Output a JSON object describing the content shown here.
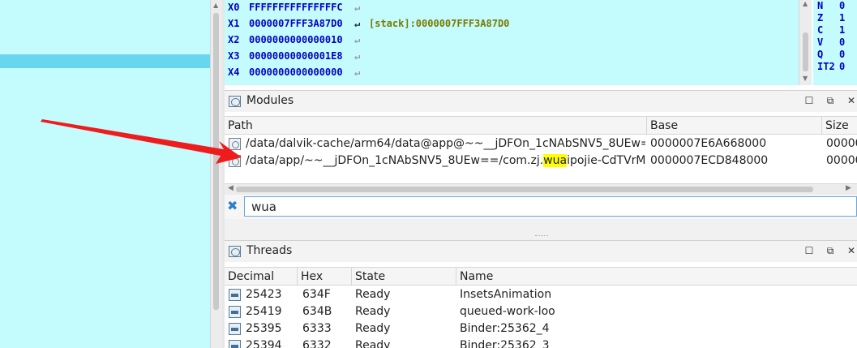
{
  "registers": [
    {
      "name": "X0",
      "value": "FFFFFFFFFFFFFFFC",
      "comment": ""
    },
    {
      "name": "X1",
      "value": "0000007FFF3A87D0",
      "comment": "[stack]:0000007FFF3A87D0"
    },
    {
      "name": "X2",
      "value": "0000000000000010",
      "comment": ""
    },
    {
      "name": "X3",
      "value": "00000000000001E8",
      "comment": ""
    },
    {
      "name": "X4",
      "value": "0000000000000000",
      "comment": ""
    }
  ],
  "flags": [
    {
      "name": "N",
      "value": "0"
    },
    {
      "name": "Z",
      "value": "1"
    },
    {
      "name": "C",
      "value": "1"
    },
    {
      "name": "V",
      "value": "0"
    },
    {
      "name": "Q",
      "value": "0"
    },
    {
      "name": "IT2",
      "value": "0"
    }
  ],
  "modules_pane": {
    "title": "Modules",
    "columns": [
      "Path",
      "Base",
      "Size"
    ],
    "rows": [
      {
        "path_pre": "/data/dalvik-cache/arm64/data@app@~~__jDFOn_1cNAbSNV5_8UEw=…",
        "path_hl": "",
        "path_post": "",
        "base": "0000007E6A668000",
        "size": "00000"
      },
      {
        "path_pre": "/data/app/~~__jDFOn_1cNAbSNV5_8UEw==/com.zj.",
        "path_hl": "wua",
        "path_post": "ipojie-CdTVrM…",
        "base": "0000007ECD848000",
        "size": "00000"
      }
    ],
    "filter_value": "wua"
  },
  "threads_pane": {
    "title": "Threads",
    "columns": [
      "Decimal",
      "Hex",
      "State",
      "Name"
    ],
    "rows": [
      {
        "decimal": "25423",
        "hex": "634F",
        "state": "Ready",
        "name": "InsetsAnimation"
      },
      {
        "decimal": "25419",
        "hex": "634B",
        "state": "Ready",
        "name": "queued-work-loo"
      },
      {
        "decimal": "25395",
        "hex": "6333",
        "state": "Ready",
        "name": "Binder:25362_4"
      },
      {
        "decimal": "25394",
        "hex": "6332",
        "state": "Ready",
        "name": "Binder:25362_3"
      }
    ]
  },
  "window_buttons": {
    "restore": "☐",
    "float": "⧉",
    "close": "✕"
  },
  "icons": {
    "return_arrow": "↵",
    "clear_filter": "✖"
  },
  "colors": {
    "register_bg": "#c4fbfc",
    "highlight_row": "#67d7ef",
    "annotation_arrow": "#ee1c1c",
    "search_highlight": "#ffff00"
  }
}
